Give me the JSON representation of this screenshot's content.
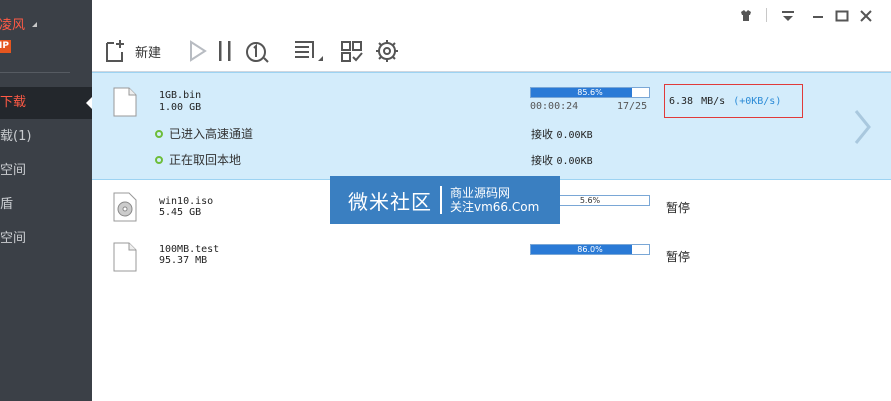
{
  "sidebar": {
    "user_name": "凌风",
    "vip_label": "IP",
    "nav": [
      {
        "label": "下载",
        "active": true
      },
      {
        "label": "载(1)"
      },
      {
        "label": "空间"
      },
      {
        "label": "盾"
      },
      {
        "label": "空间"
      }
    ]
  },
  "toolbar": {
    "new_label": "新建"
  },
  "titlebar": {
    "controls": [
      "skin-icon",
      "menu-icon",
      "minimize-icon",
      "maximize-icon",
      "close-icon"
    ]
  },
  "tasks": [
    {
      "name": "1GB.bin",
      "size": "1.00 GB",
      "progress": 85.6,
      "progress_text": "85.6%",
      "elapsed": "00:00:24",
      "connections": "17/25",
      "speed": "6.38",
      "speed_unit": "MB/s",
      "upload_speed": "(+0KB/s)",
      "status_lines": [
        {
          "label": "已进入高速通道",
          "recv_label": "接收",
          "recv_value": "0.00KB"
        },
        {
          "label": "正在取回本地",
          "recv_label": "接收",
          "recv_value": "0.00KB"
        }
      ]
    },
    {
      "name": "win10.iso",
      "size": "5.45 GB",
      "progress": 5.6,
      "progress_text": "5.6%",
      "state": "暂停"
    },
    {
      "name": "100MB.test",
      "size": "95.37 MB",
      "progress": 86.0,
      "progress_text": "86.0%",
      "state": "暂停"
    }
  ],
  "watermark": {
    "main": "微米社区",
    "line1": "商业源码网",
    "line2": "关注vm66.Com"
  },
  "colors": {
    "sidebar_bg": "#3b4047",
    "accent_red": "#ff5a45",
    "selected_row": "#d3ecfb",
    "progress_fill": "#2a7ad6",
    "speed_box_border": "#e03a3a",
    "watermark_bg": "#3a7fc1"
  }
}
